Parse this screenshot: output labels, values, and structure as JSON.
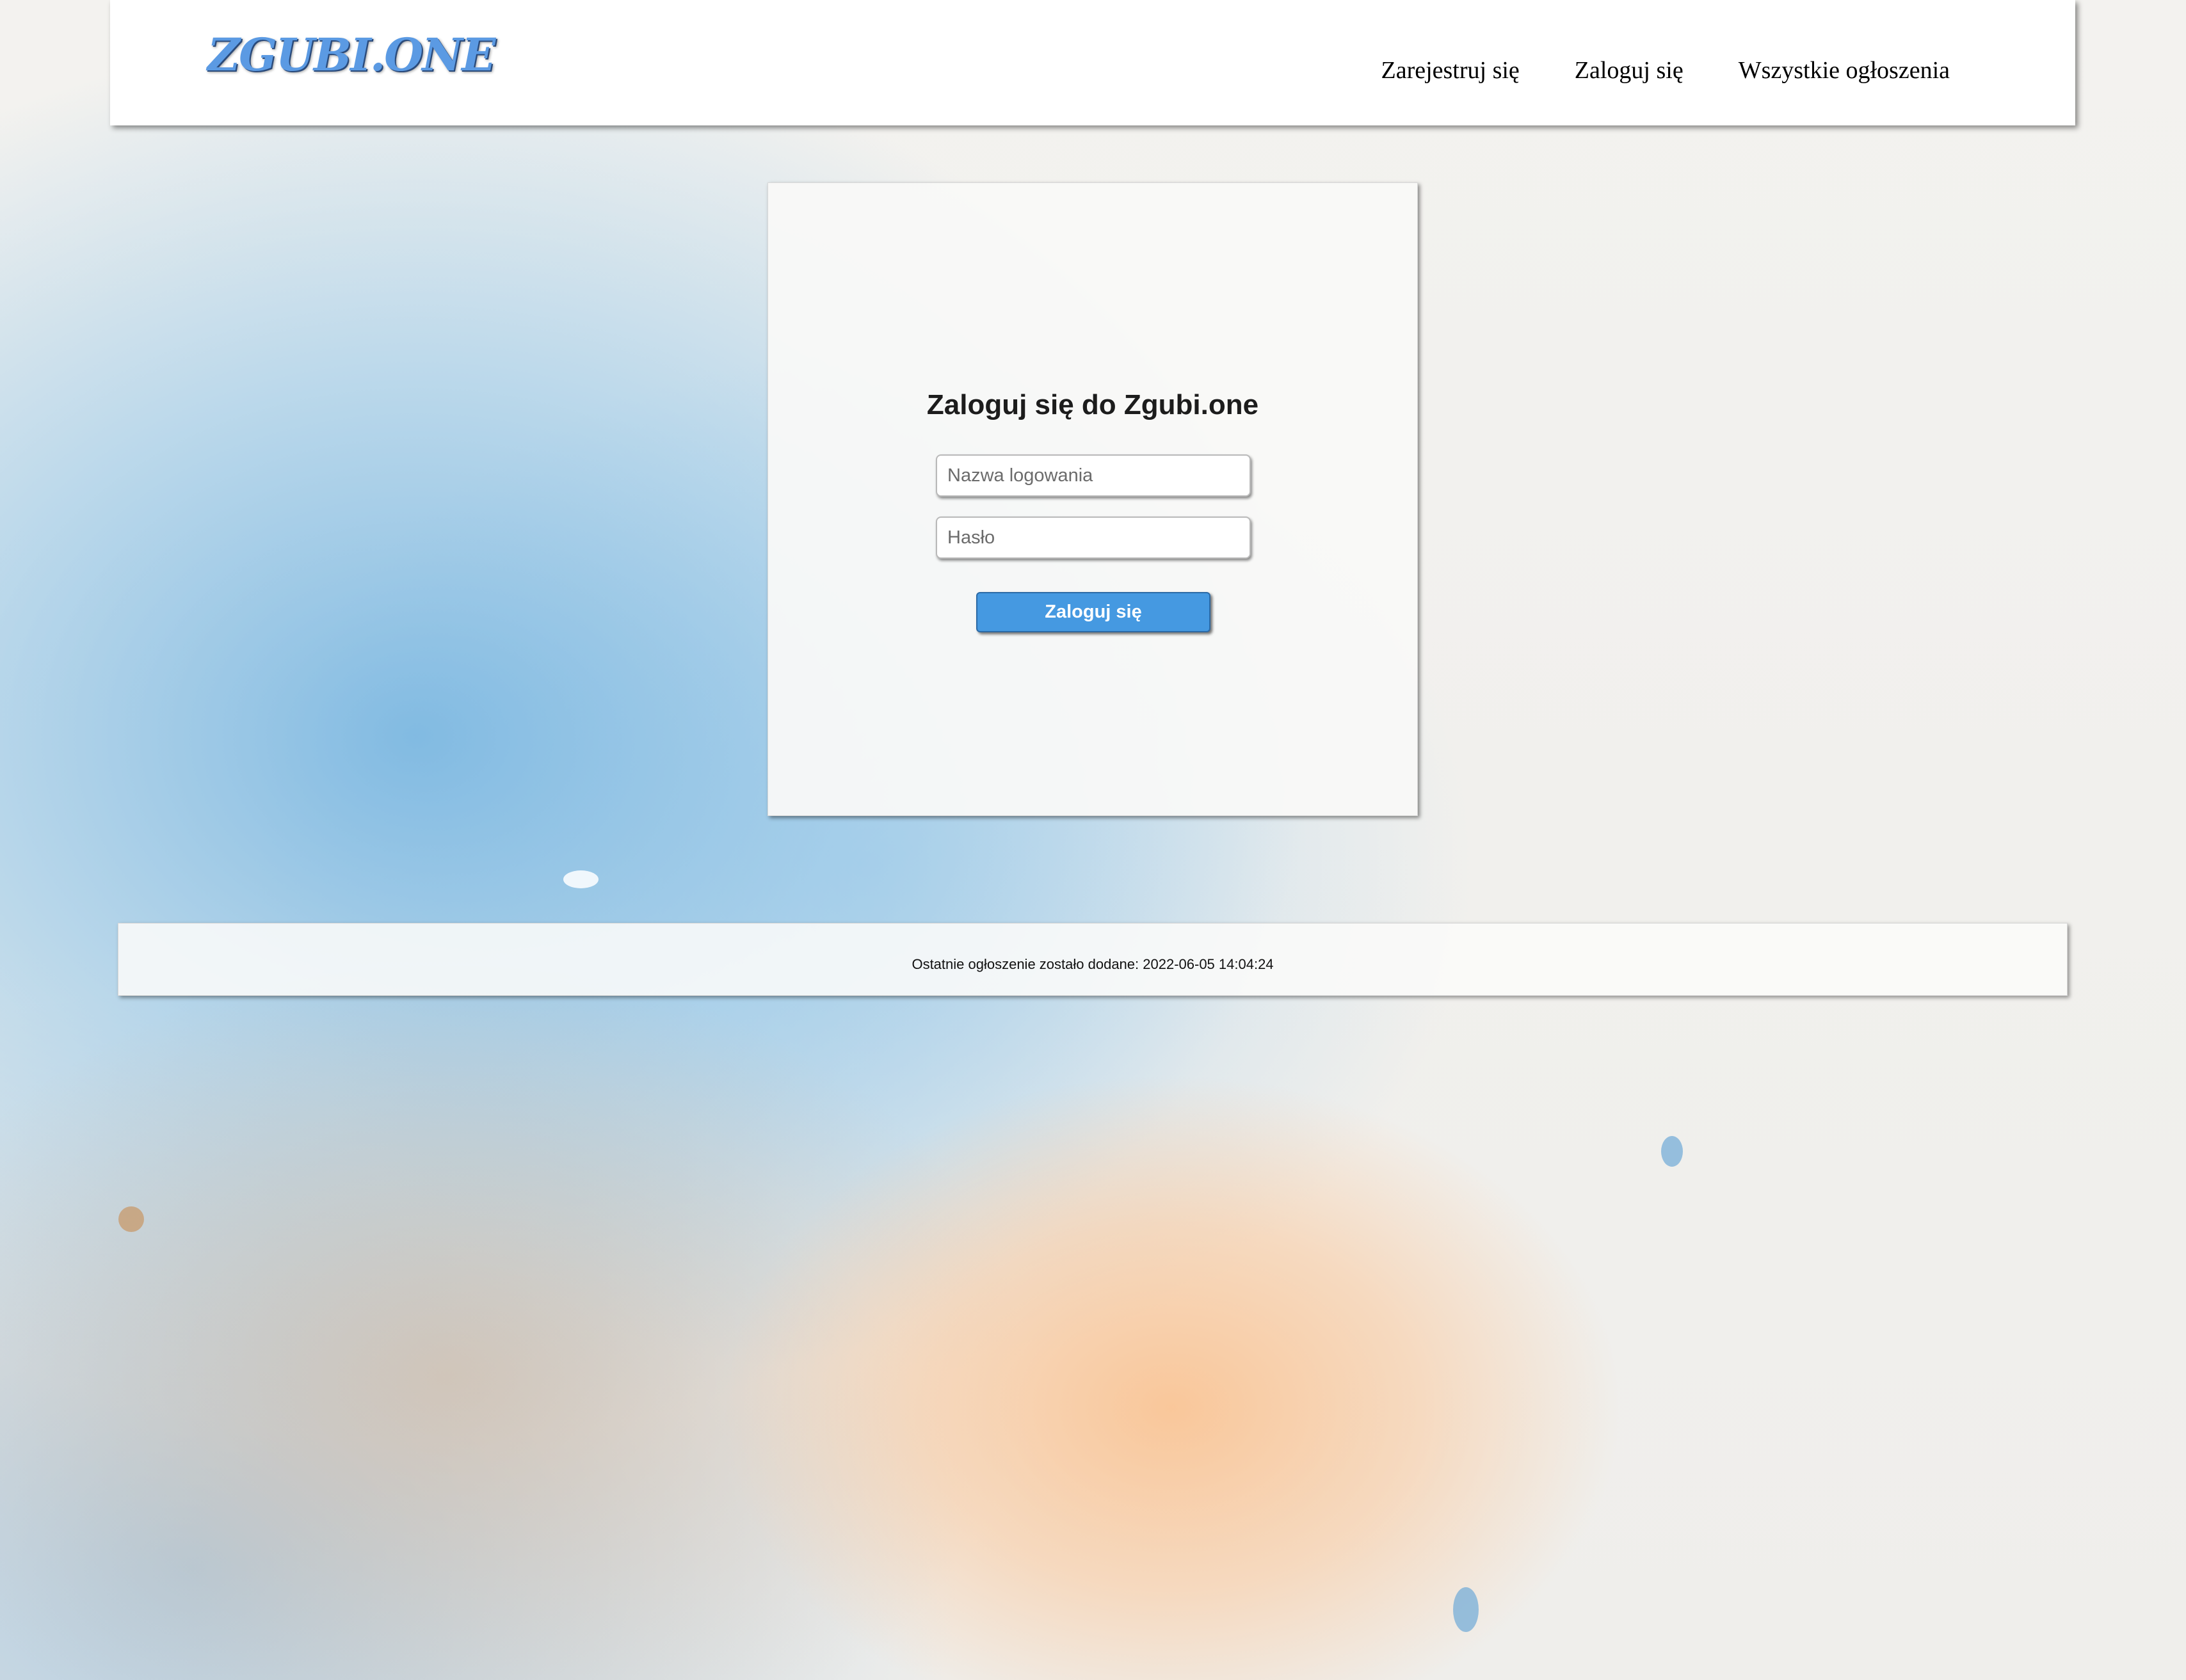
{
  "header": {
    "logo": "ZGUBI.ONE",
    "nav": {
      "register": "Zarejestruj się",
      "login": "Zaloguj się",
      "all_ads": "Wszystkie ogłoszenia"
    }
  },
  "login_form": {
    "title": "Zaloguj się do Zgubi.one",
    "username": {
      "placeholder": "Nazwa logowania",
      "value": ""
    },
    "password": {
      "placeholder": "Hasło",
      "value": ""
    },
    "submit_label": "Zaloguj się"
  },
  "footer": {
    "last_ad_text": "Ostatnie ogłoszenie zostało dodane: 2022-06-05 14:04:24"
  },
  "colors": {
    "accent": "#4599e1",
    "logo": "#5b9ae3",
    "background": "#f2f1ee"
  }
}
